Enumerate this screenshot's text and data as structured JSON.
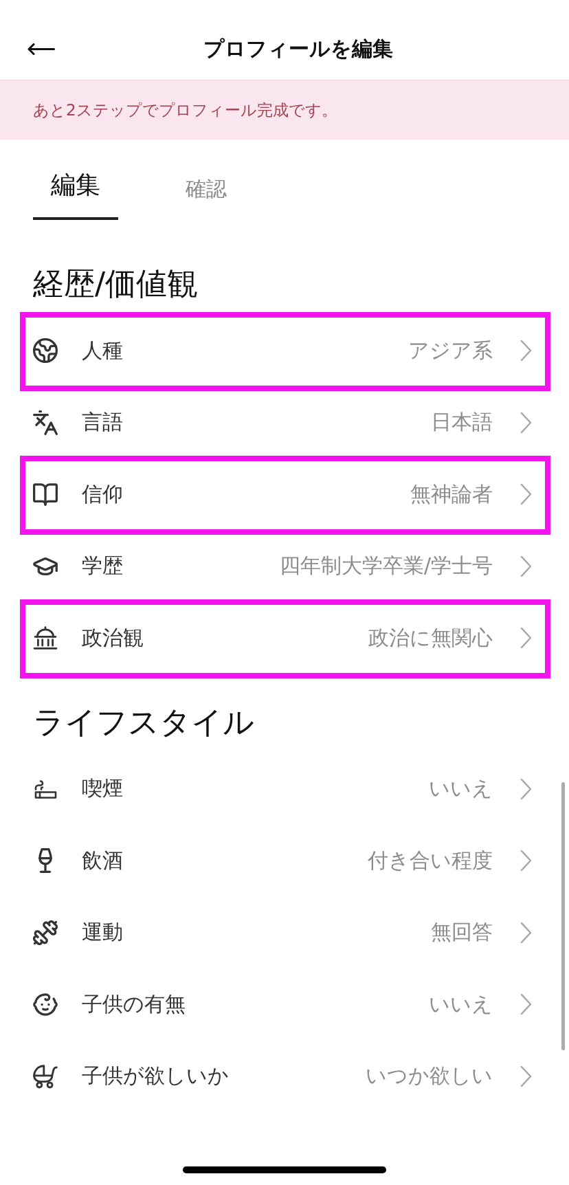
{
  "header": {
    "title": "プロフィールを編集"
  },
  "banner": {
    "message": "あと2ステップでプロフィール完成です。"
  },
  "tabs": [
    {
      "label": "編集",
      "selected": true
    },
    {
      "label": "確認",
      "selected": false
    }
  ],
  "sections": [
    {
      "title": "経歴/価値観",
      "rows": [
        {
          "label": "人種",
          "value": "アジア系",
          "highlighted": true
        },
        {
          "label": "言語",
          "value": "日本語",
          "highlighted": false
        },
        {
          "label": "信仰",
          "value": "無神論者",
          "highlighted": true
        },
        {
          "label": "学歴",
          "value": "四年制大学卒業/学士号",
          "highlighted": false
        },
        {
          "label": "政治観",
          "value": "政治に無関心",
          "highlighted": true
        }
      ]
    },
    {
      "title": "ライフスタイル",
      "rows": [
        {
          "label": "喫煙",
          "value": "いいえ",
          "highlighted": false
        },
        {
          "label": "飲酒",
          "value": "付き合い程度",
          "highlighted": false
        },
        {
          "label": "運動",
          "value": "無回答",
          "highlighted": false
        },
        {
          "label": "子供の有無",
          "value": "いいえ",
          "highlighted": false
        },
        {
          "label": "子供が欲しいか",
          "value": "いつか欲しい",
          "highlighted": false
        }
      ]
    }
  ]
}
